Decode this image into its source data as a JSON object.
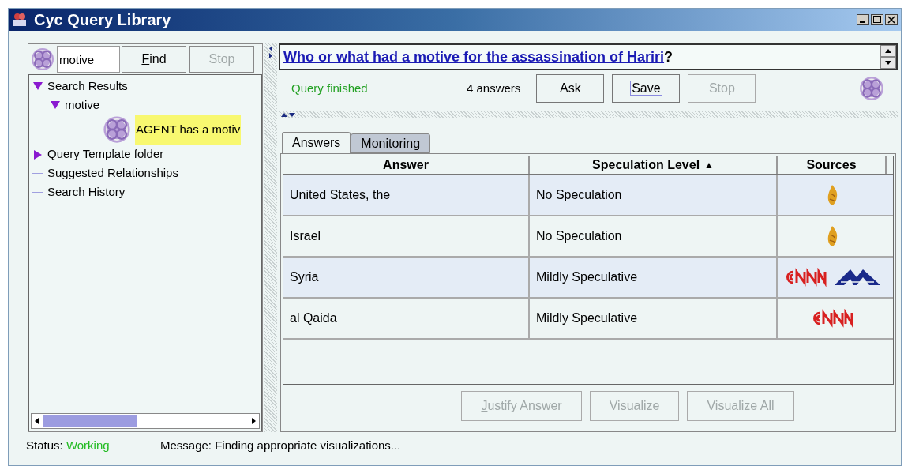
{
  "window": {
    "title": "Cyc Query Library"
  },
  "search": {
    "value": "motive",
    "buttons": [
      {
        "label": "Find",
        "disabled": false,
        "mnemonic": true
      },
      {
        "label": "Stop",
        "disabled": true,
        "mnemonic": false
      }
    ]
  },
  "tree": [
    {
      "label": "Search Results",
      "expanded": true,
      "selected": false,
      "children": [
        {
          "label": "motive",
          "expanded": true,
          "selected": false,
          "children": [
            {
              "label": "AGENT has a motiv",
              "kind": "query",
              "selected": true
            }
          ]
        }
      ]
    },
    {
      "label": "Query Template folder",
      "expanded": false,
      "selected": false
    },
    {
      "label": "Suggested Relationships",
      "selected": false
    },
    {
      "label": "Search History",
      "selected": false
    }
  ],
  "question": {
    "link": "Who or what had a motive for the assassination of Hariri",
    "suffix": "?"
  },
  "query_bar": {
    "status": "Query finished",
    "count": "4 answers",
    "buttons": [
      {
        "label": "Ask",
        "disabled": false,
        "focused": false
      },
      {
        "label": "Save",
        "disabled": false,
        "focused": true
      },
      {
        "label": "Stop",
        "disabled": true,
        "focused": false
      }
    ]
  },
  "tabs": [
    {
      "label": "Answers",
      "selected": true
    },
    {
      "label": "Monitoring",
      "selected": false
    }
  ],
  "table": {
    "columns": [
      {
        "label": "Answer"
      },
      {
        "label": "Speculation Level",
        "sort_indicator": "▲"
      },
      {
        "label": "Sources"
      }
    ],
    "rows": [
      {
        "answer": "United States, the",
        "speculation": "No Speculation",
        "sources": [
          {
            "kind": "calligraphy"
          }
        ]
      },
      {
        "answer": "Israel",
        "speculation": "No Speculation",
        "sources": [
          {
            "kind": "calligraphy"
          }
        ]
      },
      {
        "answer": "Syria",
        "speculation": "Mildly Speculative",
        "sources": [
          {
            "kind": "red_wordmark"
          },
          {
            "kind": "peaks"
          }
        ]
      },
      {
        "answer": "al Qaida",
        "speculation": "Mildly Speculative",
        "sources": [
          {
            "kind": "red_wordmark"
          }
        ]
      }
    ]
  },
  "actions": [
    {
      "label": "Justify Answer",
      "disabled": true,
      "mnemonic": true
    },
    {
      "label": "Visualize",
      "disabled": true,
      "mnemonic": false
    },
    {
      "label": "Visualize All",
      "disabled": true,
      "mnemonic": false
    }
  ],
  "status_bar": {
    "status_label": "Status:",
    "status": "Working",
    "message": "Message: Finding appropriate visualizations..."
  }
}
